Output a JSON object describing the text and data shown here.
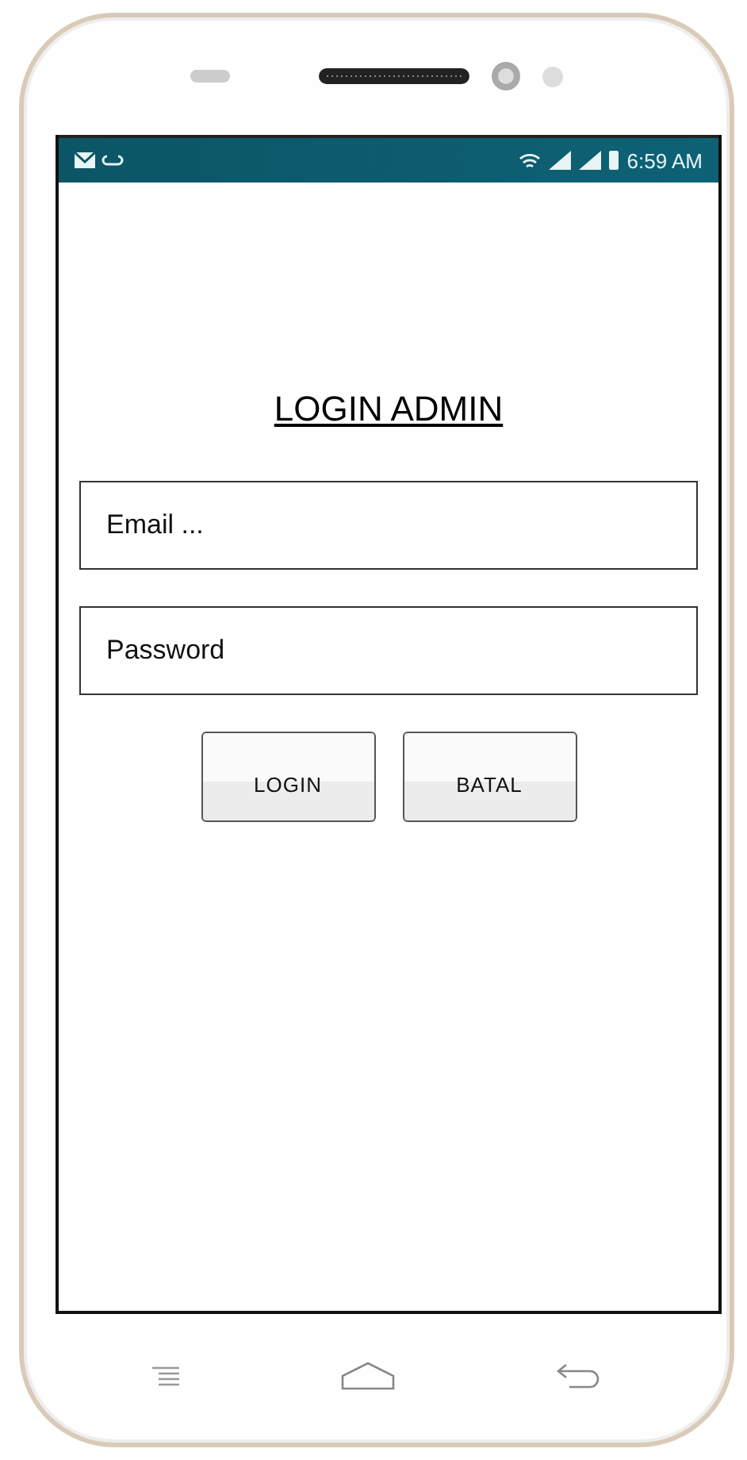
{
  "status_bar": {
    "time": "6:59 AM"
  },
  "title": "LOGIN ADMIN",
  "fields": [
    {
      "placeholder": "Email ..."
    },
    {
      "placeholder": "Password"
    }
  ],
  "buttons": [
    "LOGIN",
    "BATAL"
  ]
}
